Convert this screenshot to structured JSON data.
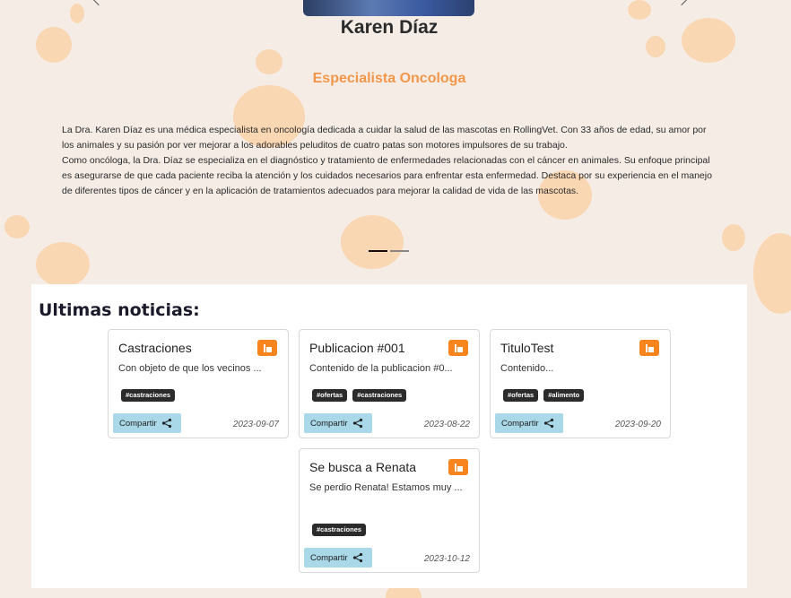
{
  "doctor": {
    "name": "Karen Díaz",
    "title": "Especialista Oncologa",
    "bio": [
      "La Dra. Karen Díaz es una médica especialista en oncología dedicada a cuidar la salud de las mascotas en RollingVet. Con 33 años de edad, su amor por los animales y su pasión por ver mejorar a los adorables peluditos de cuatro patas son motores impulsores de su trabajo.",
      "Como oncóloga, la Dra. Díaz se especializa en el diagnóstico y tratamiento de enfermedades relacionadas con el cáncer en animales. Su enfoque principal es asegurarse de que cada paciente reciba la atención y los cuidados necesarios para enfrentar esta enfermedad. Destaca por su experiencia en el manejo de diferentes tipos de cáncer y en la aplicación de tratamientos adecuados para mejorar la calidad de vida de las mascotas."
    ]
  },
  "carousel": {
    "slide_count": 2,
    "active_index": 0
  },
  "news": {
    "heading": "Ultimas noticias:",
    "share_label": "Compartir",
    "cards": [
      {
        "title": "Castraciones",
        "excerpt": "Con objeto de que los vecinos ...",
        "tags": [
          "#castraciones"
        ],
        "date": "2023-09-07"
      },
      {
        "title": "Publicacion #001",
        "excerpt": "Contenido de la publicacion #0...",
        "tags": [
          "#ofertas",
          "#castraciones"
        ],
        "date": "2023-08-22"
      },
      {
        "title": "TituloTest",
        "excerpt": "Contenido...",
        "tags": [
          "#ofertas",
          "#alimento"
        ],
        "date": "2023-09-20"
      },
      {
        "title": "Se busca a Renata",
        "excerpt": "Se perdio Renata! Estamos muy ...",
        "tags": [
          "#castraciones"
        ],
        "date": "2023-10-12"
      }
    ]
  },
  "colors": {
    "accent": "#f2974a",
    "badge": "#f7841c",
    "share_button": "#a9d8e8",
    "background": "#f5ece6",
    "paw": "#fad7b3"
  },
  "icons": {
    "badge": "read-more-icon",
    "share": "share-icon",
    "prev": "chevron-left-icon",
    "next": "chevron-right-icon"
  }
}
